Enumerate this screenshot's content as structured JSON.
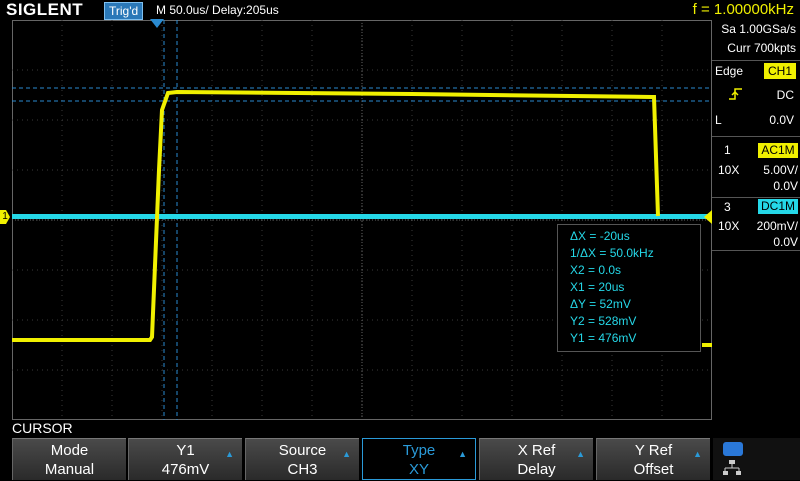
{
  "header": {
    "logo": "SIGLENT",
    "trigger_status": "Trig'd",
    "timebase": "M 50.0us/  Delay:205us",
    "frequency": "f = 1.00000kHz"
  },
  "acquisition": {
    "sample_rate": "Sa 1.00GSa/s",
    "memory": "Curr 700kpts"
  },
  "trigger": {
    "type": "Edge",
    "source": "CH1",
    "slope_icon": "rising-edge-icon",
    "coupling": "DC",
    "level_label": "L",
    "level": "0.0V"
  },
  "channels": [
    {
      "number": "1",
      "coupling": "AC1M",
      "probe": "10X",
      "scale": "5.00V/",
      "offset": "0.0V",
      "color": "#f0f000"
    },
    {
      "number": "3",
      "coupling": "DC1M",
      "probe": "10X",
      "scale": "200mV/",
      "offset": "0.0V",
      "color": "#25d8e8"
    }
  ],
  "cursor_info": {
    "dx": "ΔX = -20us",
    "inv_dx": "1/ΔX = 50.0kHz",
    "x2": "X2 = 0.0s",
    "x1": "X1 = 20us",
    "dy": "ΔY = 52mV",
    "y2": "Y2 = 528mV",
    "y1": "Y1 = 476mV"
  },
  "markers": {
    "ch1_marker": "1"
  },
  "menu": {
    "title": "CURSOR",
    "buttons": [
      {
        "label": "Mode",
        "value": "Manual",
        "has_arrow": false
      },
      {
        "label": "Y1",
        "value": "476mV",
        "has_arrow": true
      },
      {
        "label": "Source",
        "value": "CH3",
        "has_arrow": true
      },
      {
        "label": "Type",
        "value": "XY",
        "has_arrow": true
      },
      {
        "label": "X Ref",
        "value": "Delay",
        "has_arrow": true
      },
      {
        "label": "Y Ref",
        "value": "Offset",
        "has_arrow": true
      }
    ],
    "extra_icons": [
      "toggle-icon",
      "network-icon"
    ]
  },
  "colors": {
    "ch1": "#f0f000",
    "ch3": "#25d8e8",
    "accent": "#2a9ad8",
    "grid": "#444444"
  }
}
